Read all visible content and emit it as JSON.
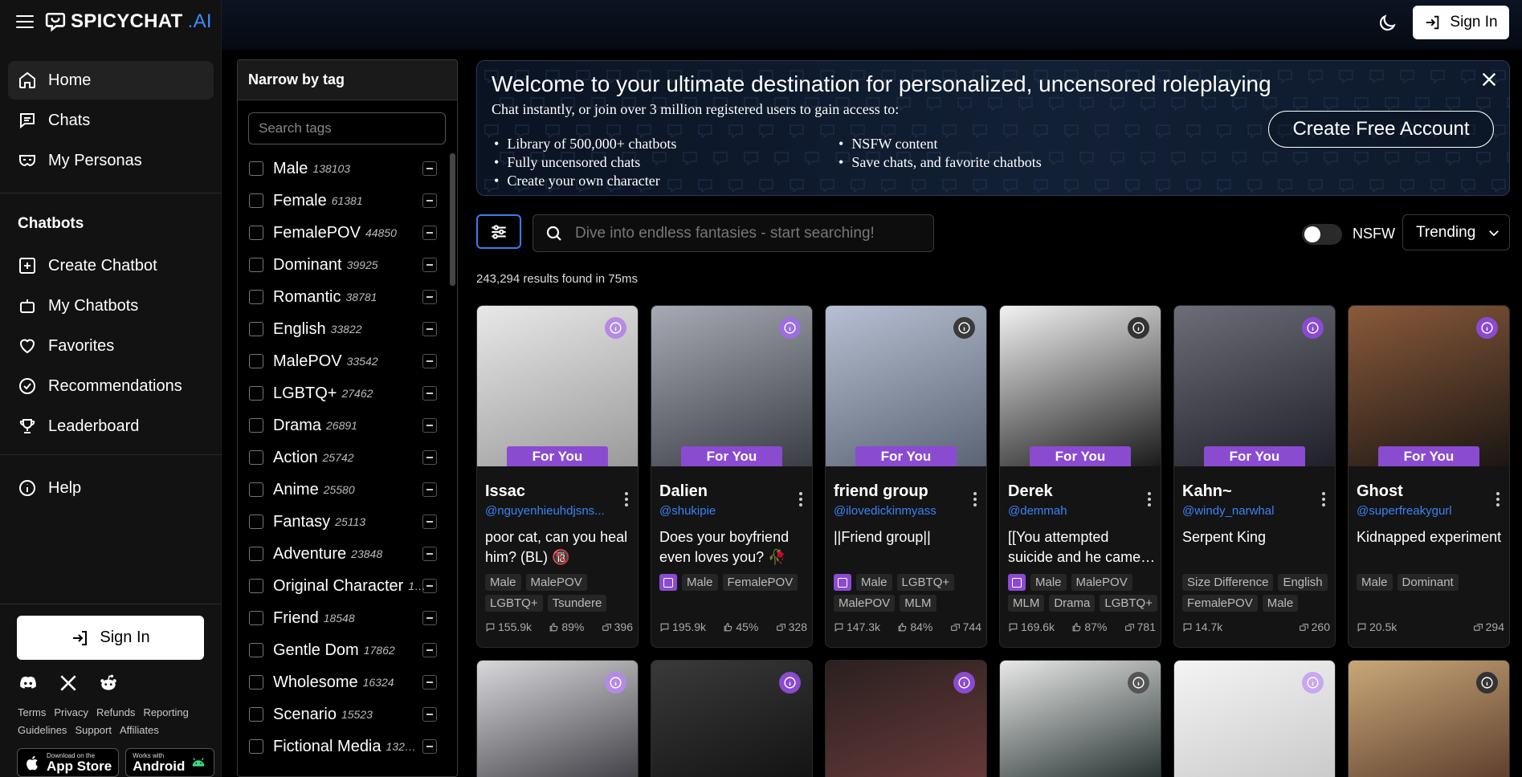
{
  "brand": {
    "name": "SPICYCHAT",
    "suffix": ".AI"
  },
  "sidebar": {
    "nav": [
      {
        "label": "Home",
        "icon": "home-icon"
      },
      {
        "label": "Chats",
        "icon": "chat-icon"
      },
      {
        "label": "My Personas",
        "icon": "mask-icon"
      }
    ],
    "section_title": "Chatbots",
    "chatbots": [
      {
        "label": "Create Chatbot",
        "icon": "plus-square-icon"
      },
      {
        "label": "My Chatbots",
        "icon": "bot-icon"
      },
      {
        "label": "Favorites",
        "icon": "heart-icon"
      },
      {
        "label": "Recommendations",
        "icon": "check-badge-icon"
      },
      {
        "label": "Leaderboard",
        "icon": "trophy-icon"
      }
    ],
    "help": "Help",
    "signin": "Sign In",
    "footer_links": [
      "Terms",
      "Privacy",
      "Refunds",
      "Reporting",
      "Guidelines",
      "Support",
      "Affiliates"
    ],
    "app_store": {
      "small": "Download on the",
      "big": "App Store"
    },
    "android": {
      "small": "Works with",
      "big": "Android"
    }
  },
  "topbar": {
    "signin": "Sign In"
  },
  "tags": {
    "title": "Narrow by tag",
    "search_placeholder": "Search tags",
    "items": [
      {
        "name": "Male",
        "count": "138103"
      },
      {
        "name": "Female",
        "count": "61381"
      },
      {
        "name": "FemalePOV",
        "count": "44850"
      },
      {
        "name": "Dominant",
        "count": "39925"
      },
      {
        "name": "Romantic",
        "count": "38781"
      },
      {
        "name": "English",
        "count": "33822"
      },
      {
        "name": "MalePOV",
        "count": "33542"
      },
      {
        "name": "LGBTQ+",
        "count": "27462"
      },
      {
        "name": "Drama",
        "count": "26891"
      },
      {
        "name": "Action",
        "count": "25742"
      },
      {
        "name": "Anime",
        "count": "25580"
      },
      {
        "name": "Fantasy",
        "count": "25113"
      },
      {
        "name": "Adventure",
        "count": "23848"
      },
      {
        "name": "Original Character",
        "count": "1…"
      },
      {
        "name": "Friend",
        "count": "18548"
      },
      {
        "name": "Gentle Dom",
        "count": "17862"
      },
      {
        "name": "Wholesome",
        "count": "16324"
      },
      {
        "name": "Scenario",
        "count": "15523"
      },
      {
        "name": "Fictional Media",
        "count": "132…"
      }
    ]
  },
  "banner": {
    "title": "Welcome to your ultimate destination for personalized, uncensored roleplaying",
    "subtitle": "Chat instantly, or join over 3 million registered users to gain access to:",
    "col1": [
      "Library of 500,000+ chatbots",
      "Fully uncensored chats",
      "Create your own character"
    ],
    "col2": [
      "NSFW content",
      "Save chats, and favorite chatbots"
    ],
    "cta": "Create Free Account"
  },
  "search": {
    "placeholder": "Dive into endless fantasies - start searching!"
  },
  "nsfw_label": "NSFW",
  "sort": {
    "selected": "Trending"
  },
  "results_text": "243,294 results found in 75ms",
  "cards": [
    {
      "name": "Issac",
      "handle": "@nguyenhieuhdjsns...",
      "desc": "poor cat, can you heal him? (BL) 🔞",
      "badge": "For You",
      "tags": [
        "Male",
        "MalePOV",
        "LGBTQ+",
        "Tsundere"
      ],
      "has_img_tag": false,
      "messages": "155.9k",
      "rating": "89%",
      "bots": "396",
      "bg": [
        "#e8e8e8",
        "#9a9a9a"
      ],
      "info_color": "#b48ae6"
    },
    {
      "name": "Dalien",
      "handle": "@shukipie",
      "desc": "Does your boyfriend even loves you? 🥀",
      "badge": "For You",
      "tags": [
        "Male",
        "FemalePOV"
      ],
      "has_img_tag": true,
      "messages": "195.9k",
      "rating": "45%",
      "bots": "328",
      "bg": [
        "#a7aab4",
        "#3a3d44"
      ],
      "info_color": "#9b6fe0"
    },
    {
      "name": "friend group",
      "handle": "@ilovedickinmyass",
      "desc": "||Friend group||",
      "badge": "For You",
      "tags": [
        "Male",
        "LGBTQ+",
        "MalePOV",
        "MLM"
      ],
      "has_img_tag": true,
      "messages": "147.3k",
      "rating": "84%",
      "bots": "744",
      "bg": [
        "#b6c0d2",
        "#5a6474"
      ],
      "info_color": "#3a3a3a"
    },
    {
      "name": "Derek",
      "handle": "@demmah",
      "desc": "[[You attempted suicide and he came…",
      "badge": "For You",
      "tags": [
        "Male",
        "MalePOV",
        "MLM",
        "Drama",
        "LGBTQ+"
      ],
      "has_img_tag": true,
      "messages": "169.6k",
      "rating": "87%",
      "bots": "781",
      "bg": [
        "#f2f2f2",
        "#1a1a1a"
      ],
      "info_color": "#333333"
    },
    {
      "name": "Kahn~",
      "handle": "@windy_narwhal",
      "desc": "Serpent King",
      "badge": "For You",
      "tags": [
        "Size Difference",
        "English",
        "FemalePOV",
        "Male"
      ],
      "has_img_tag": false,
      "messages": "14.7k",
      "rating": "",
      "bots": "260",
      "bg": [
        "#6c6d78",
        "#1f2028"
      ],
      "info_color": "#8a4bd1"
    },
    {
      "name": "Ghost",
      "handle": "@superfreakygurl",
      "desc": "Kidnapped experiment",
      "badge": "For You",
      "tags": [
        "Male",
        "Dominant"
      ],
      "has_img_tag": false,
      "messages": "20.5k",
      "rating": "",
      "bots": "294",
      "bg": [
        "#8a5a3a",
        "#1b1613"
      ],
      "info_color": "#8a4bd1"
    }
  ],
  "cards_row2": [
    {
      "bg": [
        "#d8d8dc",
        "#3a3a40"
      ],
      "info_color": "#b48ae6"
    },
    {
      "bg": [
        "#3a3a3a",
        "#111111"
      ],
      "info_color": "#8a4bd1"
    },
    {
      "bg": [
        "#2a2020",
        "#6a3a3a"
      ],
      "info_color": "#8a4bd1"
    },
    {
      "bg": [
        "#e8e8e8",
        "#1e2a28"
      ],
      "info_color": "#555555"
    },
    {
      "bg": [
        "#f4f4f4",
        "#c8c8c8"
      ],
      "info_color": "#c8a8ee"
    },
    {
      "bg": [
        "#c8a878",
        "#5a3a2a"
      ],
      "info_color": "#333333"
    }
  ]
}
